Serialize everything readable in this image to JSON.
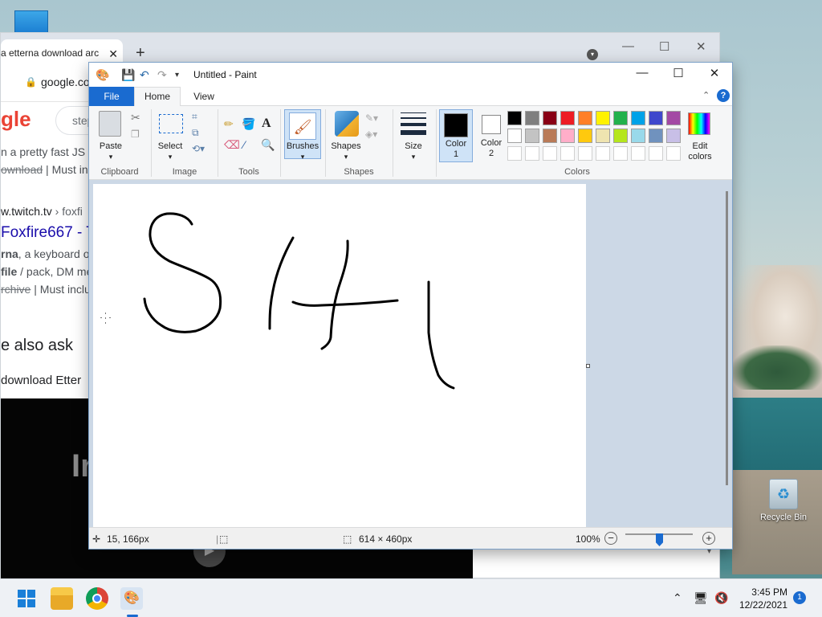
{
  "desktop": {
    "recycle_bin_label": "Recycle Bin"
  },
  "chrome": {
    "tab_title": "a etterna download arc",
    "tab_close": "✕",
    "new_tab": "+",
    "window_controls": [
      "—",
      "☐",
      "✕"
    ],
    "url": "google.co",
    "google_logo_fragment": "gle",
    "search_text": "step",
    "results": [
      {
        "kind": "line",
        "text": "n a pretty fast JS"
      },
      {
        "kind": "line_strike",
        "strike": "ownload",
        "rest": " | Must in"
      },
      {
        "kind": "cite",
        "text": "w.twitch.tv",
        "rest": " › foxfi"
      },
      {
        "kind": "title",
        "text": "Foxfire667 - T"
      },
      {
        "kind": "line_bold",
        "bold": "rna",
        "rest": ", a keyboard ori"
      },
      {
        "kind": "line_bold",
        "bold": " file",
        "rest": " / pack, DM me"
      },
      {
        "kind": "line_strike",
        "strike": "rchive",
        "rest": " | Must inclu"
      },
      {
        "kind": "heading",
        "text": "e also ask"
      },
      {
        "kind": "line",
        "text": " download Etter"
      }
    ],
    "video_overlay_text": "Ir",
    "scroll_down": "▾"
  },
  "paint": {
    "title": "Untitled - Paint",
    "window_controls": [
      "—",
      "☐",
      "✕"
    ],
    "tabs": [
      "File",
      "Home",
      "View"
    ],
    "help": "?",
    "groups": {
      "clipboard": {
        "label": "Clipboard",
        "paste": "Paste"
      },
      "image": {
        "label": "Image",
        "select": "Select"
      },
      "tools": {
        "label": "Tools"
      },
      "brushes": {
        "label": "Brushes"
      },
      "shapes": {
        "label": "Shapes",
        "shapes_btn": "Shapes"
      },
      "size": {
        "label": "Size"
      },
      "colors": {
        "label": "Colors",
        "color1": [
          "Color",
          "1"
        ],
        "color2": [
          "Color",
          "2"
        ],
        "edit_colors": [
          "Edit",
          "colors"
        ],
        "row1": [
          "#000000",
          "#7f7f7f",
          "#880015",
          "#ed1c24",
          "#ff7f27",
          "#fff200",
          "#22b14c",
          "#00a2e8",
          "#3f48cc",
          "#a349a4"
        ],
        "row2": [
          "#ffffff",
          "#c3c3c3",
          "#b97a57",
          "#ffaec9",
          "#ffc90e",
          "#efe4b0",
          "#b5e61d",
          "#99d9ea",
          "#7092be",
          "#c8bfe7"
        ],
        "row3": [
          "#ffffff",
          "#ffffff",
          "#ffffff",
          "#ffffff",
          "#ffffff",
          "#ffffff",
          "#ffffff",
          "#ffffff",
          "#ffffff",
          "#ffffff"
        ]
      }
    },
    "status": {
      "cursor_pos": "15, 166px",
      "canvas_size": "614 × 460px",
      "zoom": "100%",
      "zoom_level": 0.5
    }
  },
  "taskbar": {
    "time": "3:45 PM",
    "date": "12/22/2021",
    "notification_count": "1"
  }
}
